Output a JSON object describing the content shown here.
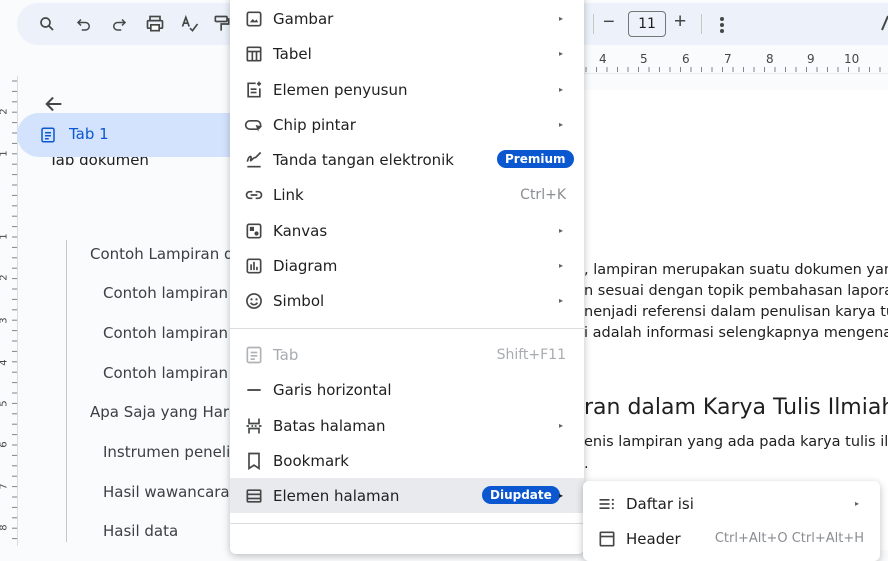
{
  "toolbar": {
    "icons": [
      "search-icon",
      "undo-icon",
      "redo-icon",
      "print-icon",
      "spellcheck-icon",
      "paint-format-icon"
    ],
    "font_size": "11",
    "minus": "−",
    "plus": "+"
  },
  "ruler": {
    "numbers": [
      "4",
      "5",
      "6",
      "7",
      "8",
      "9",
      "10"
    ],
    "left_numbers": [
      "2",
      "1",
      "1",
      "2",
      "3",
      "4",
      "5",
      "6",
      "7",
      "8"
    ]
  },
  "sidebar": {
    "title": "Tab dokumen",
    "tab": "Tab 1",
    "outline": [
      "Contoh Lampiran da",
      "Contoh lampiran r",
      "Contoh lampiran s",
      "Contoh lampiran a",
      "Apa Saja yang Haru",
      "Instrumen peneliti",
      "Hasil wawancara a",
      "Hasil data"
    ]
  },
  "document": {
    "lines": [
      ", lampiran merupakan suatu dokumen yang",
      "n sesuai dengan topik pembahasan lapora",
      "nenjadi referensi dalam penulisan karya tul",
      "i adalah informasi selengkapnya mengenai"
    ],
    "heading": "ran dalam Karya Tulis Ilmiah",
    "line2": "enis lampiran yang ada pada karya tulis ilm",
    "line3": "."
  },
  "menu": {
    "items": [
      {
        "label": "Gambar",
        "icon": "image-icon",
        "arrow": "▸"
      },
      {
        "label": "Tabel",
        "icon": "table-icon",
        "arrow": "▸"
      },
      {
        "label": "Elemen penyusun",
        "icon": "building-blocks-icon",
        "arrow": "▸"
      },
      {
        "label": "Chip pintar",
        "icon": "smart-chip-icon",
        "arrow": "▸"
      },
      {
        "label": "Tanda tangan elektronik",
        "icon": "signature-icon",
        "badge": "Premium"
      },
      {
        "label": "Link",
        "icon": "link-icon",
        "shortcut": "Ctrl+K"
      },
      {
        "label": "Kanvas",
        "icon": "drawing-icon",
        "arrow": "▸"
      },
      {
        "label": "Diagram",
        "icon": "chart-icon",
        "arrow": "▸"
      },
      {
        "label": "Simbol",
        "icon": "emoji-icon",
        "arrow": "▸"
      },
      {
        "label": "Tab",
        "icon": "tab-icon",
        "shortcut": "Shift+F11"
      },
      {
        "label": "Garis horizontal",
        "icon": "horizontal-line-icon"
      },
      {
        "label": "Batas halaman",
        "icon": "page-break-icon",
        "arrow": "▸"
      },
      {
        "label": "Bookmark",
        "icon": "bookmark-icon"
      },
      {
        "label": "Elemen halaman",
        "icon": "page-elements-icon",
        "badge": "Diupdate",
        "arrow": "▸"
      }
    ]
  },
  "submenu": {
    "items": [
      {
        "label": "Daftar isi",
        "icon": "toc-icon",
        "arrow": "▸"
      },
      {
        "label": "Header",
        "icon": "header-icon",
        "shortcut": "Ctrl+Alt+O Ctrl+Alt+H"
      }
    ]
  },
  "colors": {
    "accent": "#0b57d0",
    "tab_selected": "#d3e3fd",
    "toolbar_bg": "#edf2fa"
  }
}
